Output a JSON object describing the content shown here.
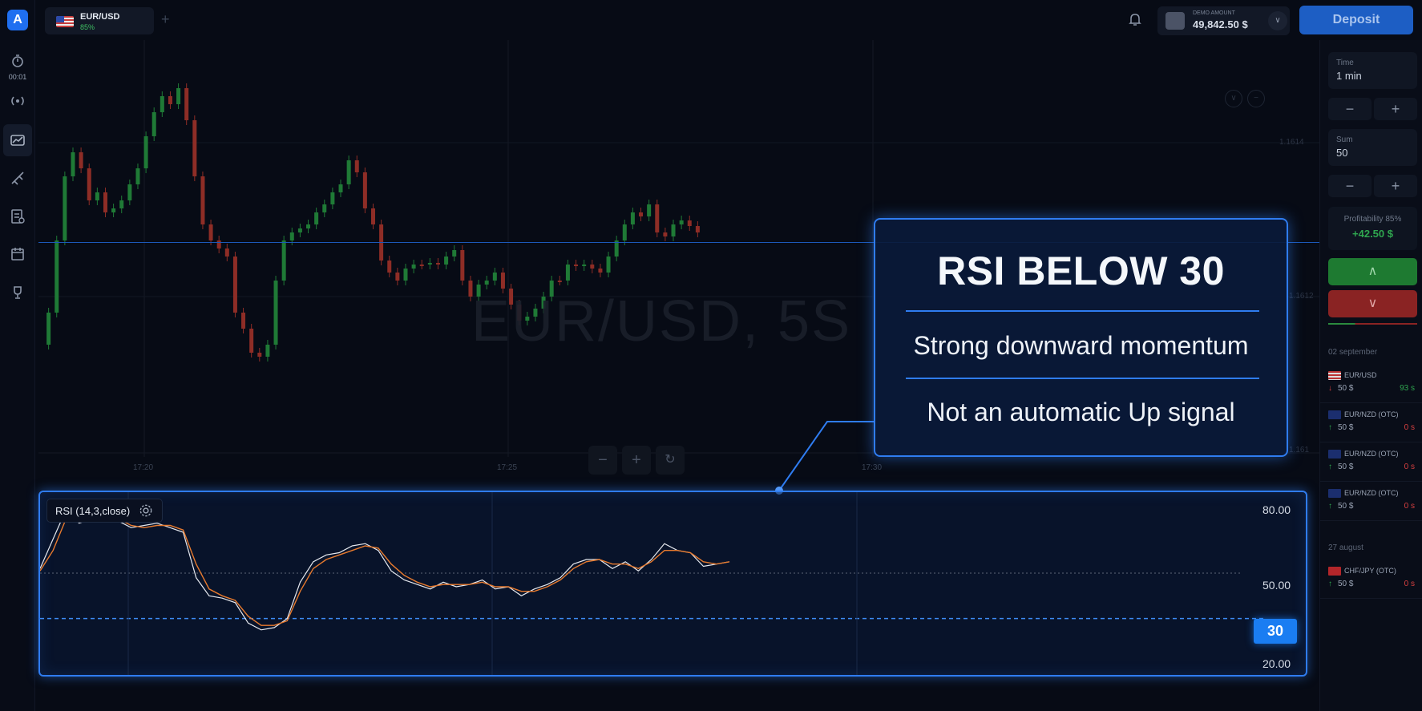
{
  "sidebar": {
    "timer": "00:01",
    "icons": [
      "logo",
      "timer-icon",
      "signal-icon",
      "chart-icon",
      "drawing-icon",
      "history-icon",
      "calendar-icon",
      "trophy-icon"
    ]
  },
  "header": {
    "asset_name": "EUR/USD",
    "asset_payout": "85%",
    "account_label": "DEMO AMOUNT",
    "account_balance": "49,842.50 $",
    "deposit_label": "Deposit"
  },
  "chart": {
    "watermark": "EUR/USD, 5S",
    "price_labels": [
      "1.1614",
      "1.1612",
      "1.161"
    ],
    "time_labels": [
      "17:20",
      "17:25",
      "17:30"
    ]
  },
  "trade_panel": {
    "time_label": "Time",
    "time_value": "1 min",
    "sum_label": "Sum",
    "sum_value": "50",
    "profitability_label": "Profitability 85%",
    "profit_value": "+42.50 $",
    "up_symbol": "∧",
    "down_symbol": "∨"
  },
  "history": {
    "date1": "02 september",
    "date2": "27 august",
    "trades": [
      {
        "name": "EUR/USD",
        "dir": "↓",
        "amount": "50 $",
        "time": "93 s",
        "time_color": "#2fa64f",
        "dir_color": "#d84040"
      },
      {
        "name": "EUR/NZD (OTC)",
        "dir": "↑",
        "amount": "50 $",
        "time": "0 s",
        "time_color": "#d84040",
        "dir_color": "#2fa64f"
      },
      {
        "name": "EUR/NZD (OTC)",
        "dir": "↑",
        "amount": "50 $",
        "time": "0 s",
        "time_color": "#d84040",
        "dir_color": "#2fa64f"
      },
      {
        "name": "EUR/NZD (OTC)",
        "dir": "↑",
        "amount": "50 $",
        "time": "0 s",
        "time_color": "#d84040",
        "dir_color": "#2fa64f"
      },
      {
        "name": "CHF/JPY (OTC)",
        "dir": "↑",
        "amount": "50 $",
        "time": "0 s",
        "time_color": "#d84040",
        "dir_color": "#2fa64f"
      }
    ]
  },
  "rsi": {
    "label": "RSI (14,3,close)",
    "scale": [
      "80.00",
      "50.00",
      "20.00"
    ],
    "threshold": "30"
  },
  "callout": {
    "title": "RSI BELOW 30",
    "line1": "Strong downward momentum",
    "line2": "Not an automatic Up signal"
  },
  "colors": {
    "accent": "#2f7cf0",
    "up": "#2fa64f",
    "down": "#d84040",
    "rsi_line": "#e6e9ef",
    "rsi_signal": "#e77a2e"
  },
  "chart_data": {
    "type": "line",
    "title": "",
    "series": [
      {
        "name": "",
        "values": [
          52,
          65,
          78,
          72,
          74,
          76,
          73,
          70,
          71,
          72,
          70,
          68,
          48,
          40,
          39,
          37,
          28,
          25,
          26,
          30,
          46,
          55,
          58,
          59,
          62,
          63,
          60,
          51,
          47,
          45,
          43,
          46,
          44,
          45,
          47,
          43,
          44,
          40,
          43,
          45,
          48,
          54,
          56,
          56,
          52,
          55,
          51,
          56,
          63,
          60,
          59,
          53,
          54,
          55
        ]
      },
      {
        "name": "",
        "values": [
          51,
          60,
          74,
          73,
          73,
          75,
          74,
          71,
          70,
          71,
          71,
          69,
          54,
          43,
          40,
          38,
          31,
          27,
          27,
          29,
          42,
          52,
          56,
          58,
          60,
          62,
          61,
          54,
          49,
          46,
          44,
          45,
          45,
          45,
          46,
          44,
          44,
          42,
          42,
          44,
          47,
          52,
          55,
          56,
          54,
          54,
          52,
          55,
          60,
          60,
          59,
          55,
          54,
          55
        ]
      }
    ],
    "ylim": [
      20,
      80
    ],
    "threshold": 30,
    "grid": true
  }
}
